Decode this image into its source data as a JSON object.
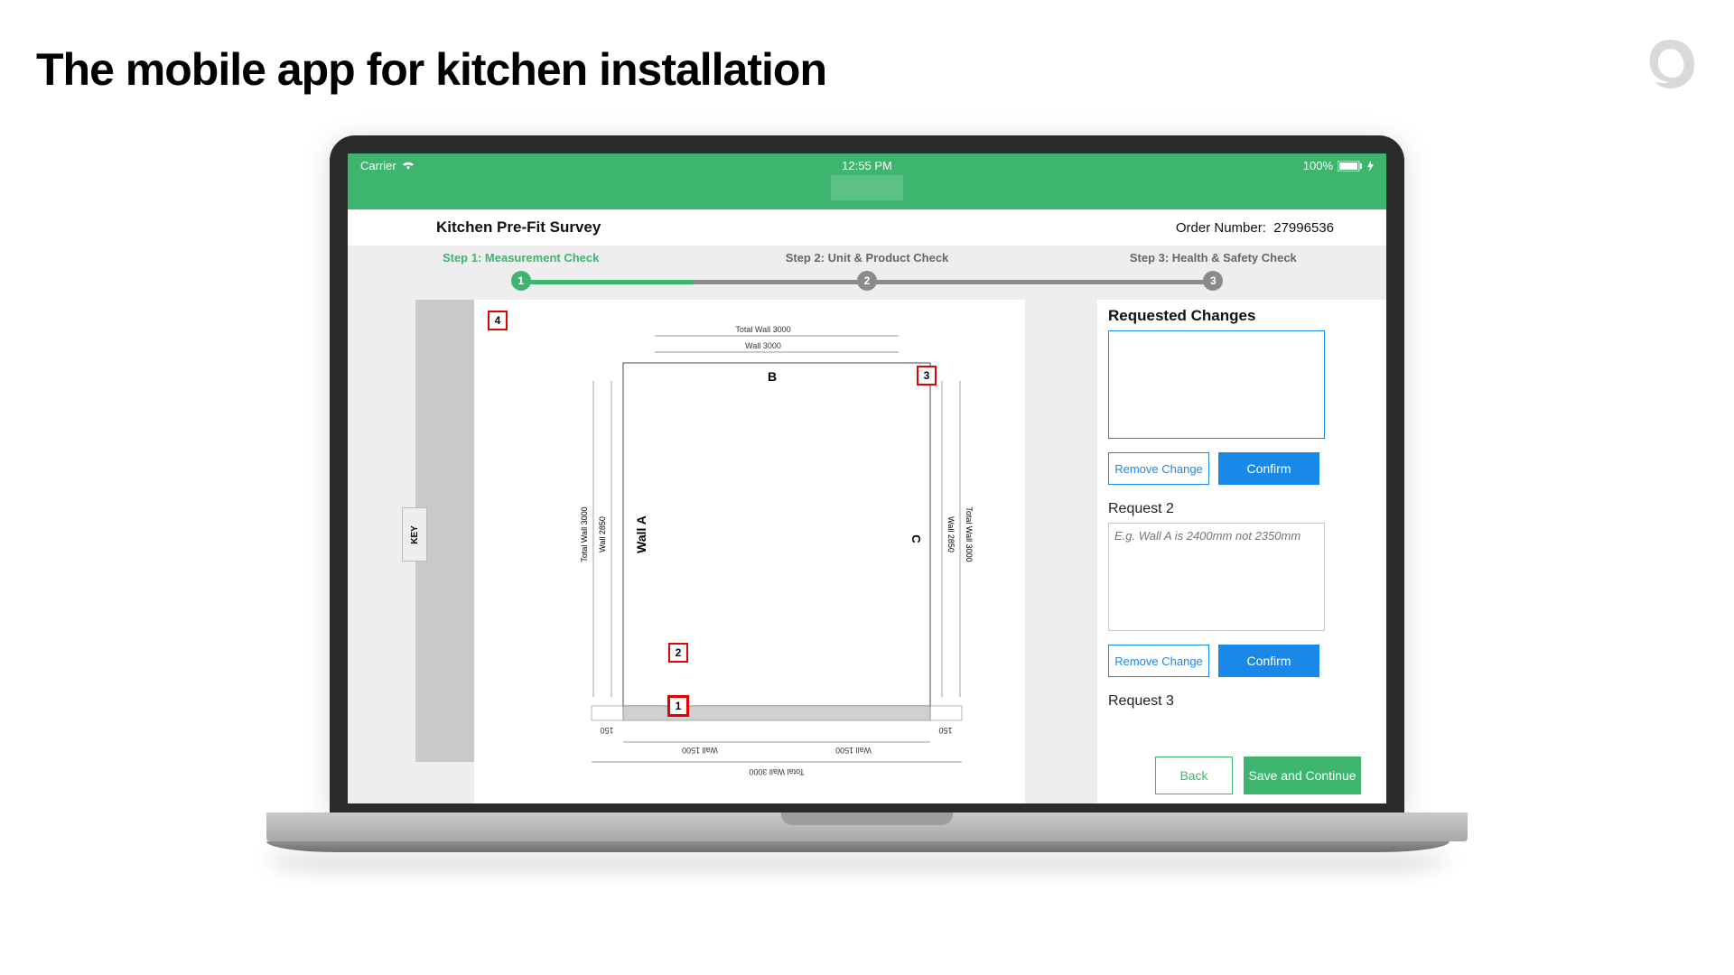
{
  "slide": {
    "title": "The mobile app for kitchen installation"
  },
  "status": {
    "carrier": "Carrier",
    "time": "12:55 PM",
    "battery": "100%"
  },
  "titlebar": {
    "title": "Kitchen Pre-Fit Survey",
    "order_label": "Order Number:",
    "order_number": "27996536"
  },
  "steps": [
    {
      "label": "Step 1: Measurement Check",
      "num": "1"
    },
    {
      "label": "Step 2: Unit & Product Check",
      "num": "2"
    },
    {
      "label": "Step 3: Health & Safety Check",
      "num": "3"
    }
  ],
  "key_tab": "KEY",
  "plan": {
    "top_total": "Total Wall 3000",
    "top_wall": "Wall 3000",
    "wall_b": "B",
    "wall_a": "Wall A",
    "left_total": "Total Wall 3000",
    "left_wall": "Wall 2850",
    "wall_c": "C",
    "right_wall": "Wall 2850",
    "right_total": "Total Wall 3000",
    "n150_l": "150",
    "n150_r": "150",
    "bot_1500_l": "Wall 1500",
    "bot_1500_r": "Wall 1500",
    "bot_total": "Total Wall 3000"
  },
  "markers": {
    "m1": "1",
    "m2": "2",
    "m3": "3",
    "m4": "4"
  },
  "panel": {
    "title": "Requested Changes",
    "remove": "Remove Change",
    "confirm": "Confirm",
    "req2": "Request 2",
    "req2_ph": "E.g. Wall A is 2400mm not 2350mm",
    "req3": "Request 3",
    "back": "Back",
    "save": "Save and Continue"
  }
}
